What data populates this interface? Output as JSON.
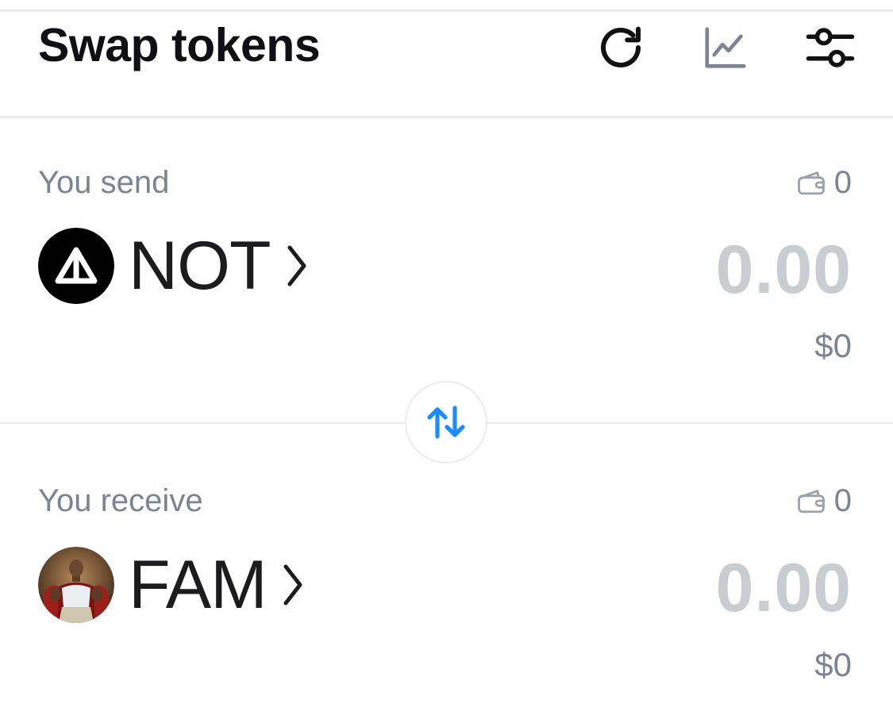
{
  "header": {
    "title": "Swap tokens",
    "icons": [
      "refresh-icon",
      "chart-icon",
      "settings-sliders-icon"
    ]
  },
  "send": {
    "label": "You send",
    "balance": "0",
    "token": "NOT",
    "token_icon": "notcoin-logo-icon",
    "amount": "0.00",
    "fiat": "$0"
  },
  "receive": {
    "label": "You receive",
    "balance": "0",
    "token": "FAM",
    "token_icon": "fam-avatar-icon",
    "amount": "0.00",
    "fiat": "$0"
  },
  "colors": {
    "accent": "#1a8cff",
    "muted_text": "#7b8491",
    "placeholder": "#c9ccd1",
    "divider": "#ececee"
  }
}
